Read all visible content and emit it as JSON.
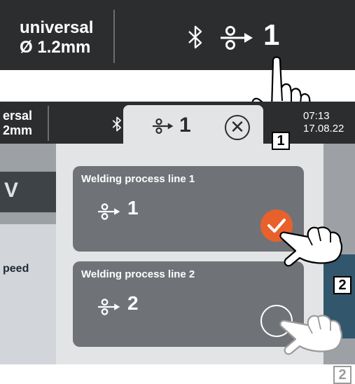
{
  "top_banner": {
    "material_line1": "universal",
    "material_line2": "Ø 1.2mm",
    "process_number": "1",
    "bluetooth_icon": "bluetooth-icon",
    "wire_feed_icon": "wire-feed-icon"
  },
  "status_bar": {
    "material_line1": "ersal",
    "material_line2": "2mm",
    "time": "07:13",
    "date": "17.08.22"
  },
  "tab": {
    "number": "1",
    "close_symbol": "✕"
  },
  "background": {
    "left_value": "V",
    "left_label": "peed"
  },
  "dialog": {
    "lines": [
      {
        "title": "Welding process line 1",
        "number": "1",
        "selected": true
      },
      {
        "title": "Welding process line 2",
        "number": "2",
        "selected": false
      }
    ]
  },
  "callouts": {
    "one": "1",
    "two_a": "2",
    "two_b": "2"
  },
  "colors": {
    "dark": "#2c2d2f",
    "accent": "#e8612c",
    "card": "#6f7378",
    "dialog": "#e3e4e6"
  }
}
